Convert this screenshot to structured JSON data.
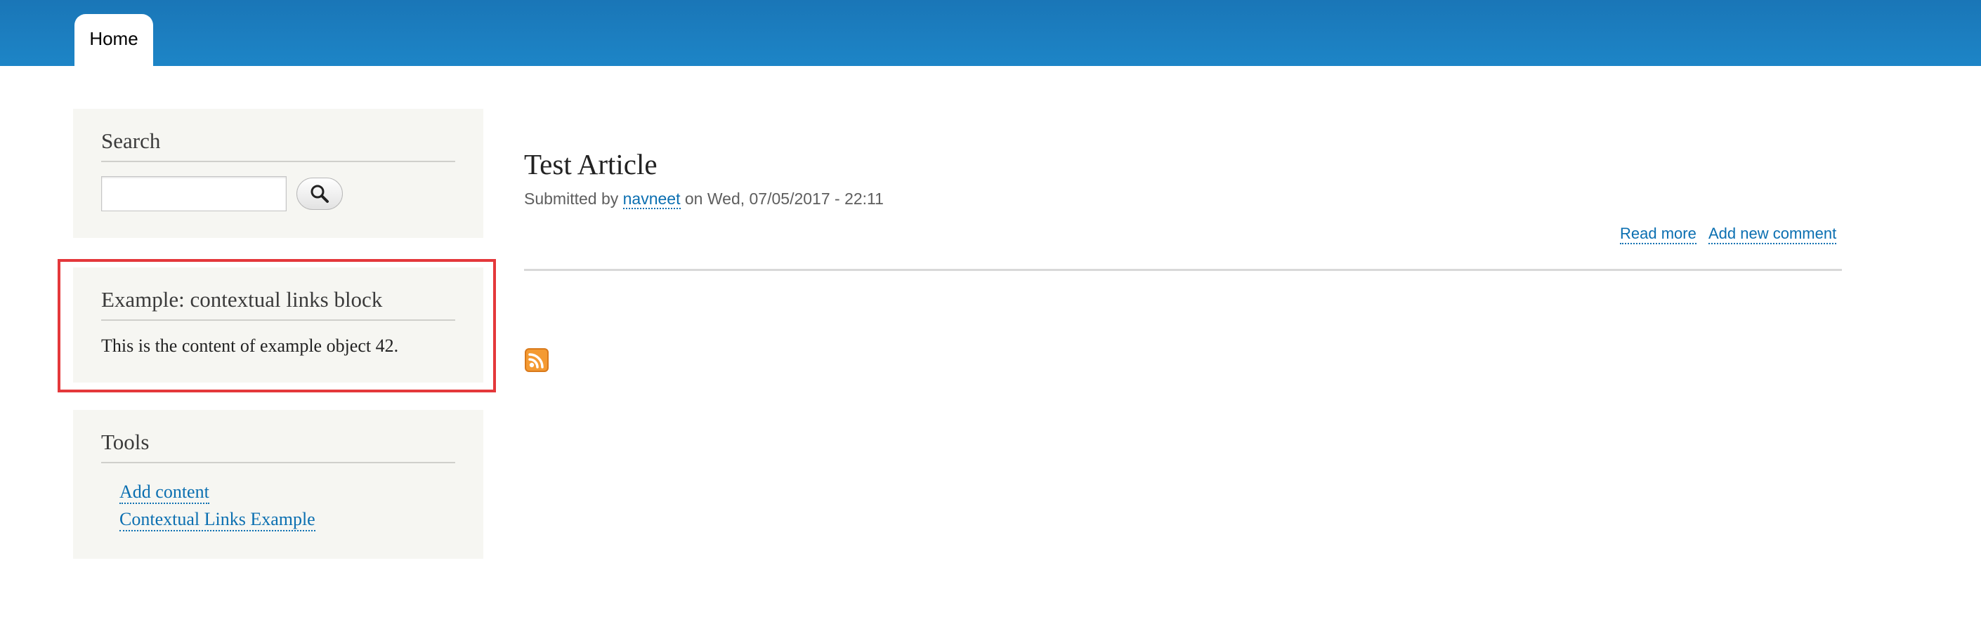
{
  "nav": {
    "tabs": [
      {
        "label": "Home"
      }
    ]
  },
  "sidebar": {
    "search": {
      "title": "Search",
      "input_value": ""
    },
    "example": {
      "title": "Example: contextual links block",
      "content": "This is the content of example object 42."
    },
    "tools": {
      "title": "Tools",
      "links": [
        {
          "label": "Add content"
        },
        {
          "label": "Contextual Links Example"
        }
      ]
    }
  },
  "article": {
    "title": "Test Article",
    "meta": {
      "prefix": "Submitted by",
      "author": "navneet",
      "date": "on Wed, 07/05/2017 - 22:11"
    },
    "links": {
      "read_more": "Read more",
      "add_comment": "Add new comment"
    }
  },
  "icons": {
    "search_button": "magnifier-icon",
    "feed": "rss-feed-icon"
  },
  "colors": {
    "header": "#1d85c7",
    "link": "#0b6fb1",
    "highlight": "#e4383b",
    "block_bg": "#f6f6f2",
    "rss": "#f49a32"
  }
}
